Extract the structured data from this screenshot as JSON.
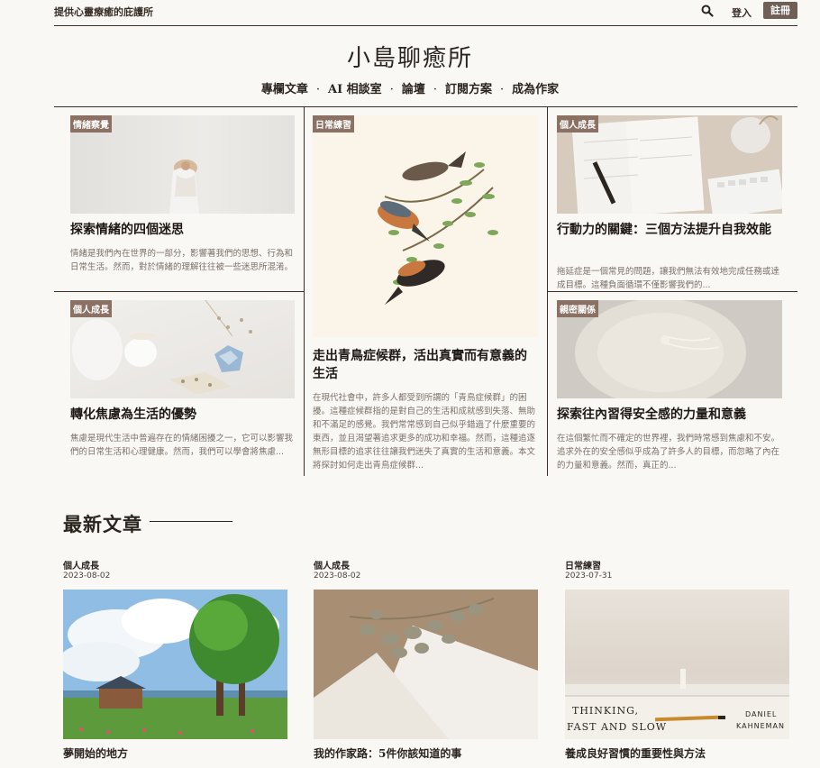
{
  "header": {
    "tagline": "提供心靈療癒的庇護所",
    "login_label": "登入",
    "register_label": "註冊",
    "search_icon": "search-icon"
  },
  "site": {
    "title": "小島聊癒所",
    "nav": [
      "專欄文章",
      "AI 相談室",
      "論壇",
      "訂閱方案",
      "成為作家"
    ]
  },
  "featured": [
    {
      "category": "情緒察覺",
      "title": "探索情緒的四個迷思",
      "excerpt": "情緒是我們內在世界的一部分，影響著我們的思想、行為和日常生活。然而，對於情緒的理解往往被一些迷思所混淆。"
    },
    {
      "category": "日常練習",
      "title": "走出青鳥症候群，活出真實而有意義的生活",
      "excerpt": "在現代社會中，許多人都受到所謂的「青鳥症候群」的困擾。這種症候群指的是對自己的生活和成就感到失落、無助和不滿足的感覺。我們常常感到自己似乎錯過了什麼重要的東西，並且渴望著追求更多的成功和幸福。然而，這種追逐無形目標的追求往往讓我們迷失了真實的生活和意義。本文將探討如何走出青鳥症候群..."
    },
    {
      "category": "個人成長",
      "title": "行動力的關鍵：三個方法提升自我效能",
      "excerpt": "拖延症是一個常見的問題，讓我們無法有效地完成任務或達成目標。這種負面循環不僅影響我們的..."
    },
    {
      "category": "個人成長",
      "title": "轉化焦慮為生活的優勢",
      "excerpt": "焦慮是現代生活中普遍存在的情緒困擾之一，它可以影響我們的日常生活和心理健康。然而，我們可以學會將焦慮..."
    },
    {
      "category": "親密關係",
      "title": "探索往內習得安全感的力量和意義",
      "excerpt": "在這個繁忙而不確定的世界裡，我們時常感到焦慮和不安。追求外在的安全感似乎成為了許多人的目標，而忽略了內在的力量和意義。然而，真正的..."
    }
  ],
  "latest": {
    "heading": "最新文章",
    "posts": [
      {
        "category": "個人成長",
        "date": "2023-08-02",
        "title": "夢開始的地方"
      },
      {
        "category": "個人成長",
        "date": "2023-08-02",
        "title": "我的作家路：5件你該知道的事"
      },
      {
        "category": "日常練習",
        "date": "2023-07-31",
        "title": "養成良好習慣的重要性與方法"
      }
    ],
    "book_cover": {
      "title_line1": "THINKING,",
      "title_line2": "FAST AND SLOW",
      "author_line1": "DANIEL",
      "author_line2": "KAHNEMAN"
    }
  }
}
